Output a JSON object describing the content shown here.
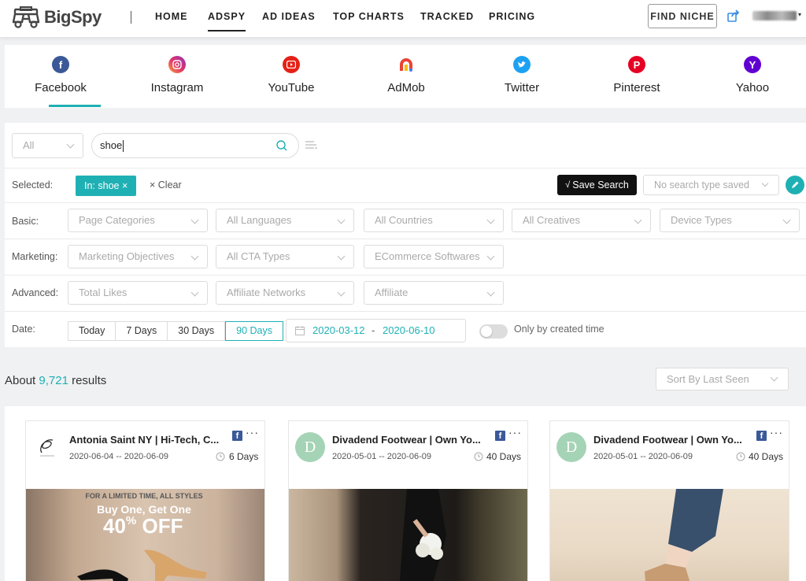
{
  "brand": {
    "name": "BigSpy"
  },
  "nav": {
    "items": [
      {
        "label": "HOME"
      },
      {
        "label": "ADSPY"
      },
      {
        "label": "AD IDEAS"
      },
      {
        "label": "TOP CHARTS"
      },
      {
        "label": "TRACKED"
      },
      {
        "label": "PRICING"
      }
    ],
    "active": "ADSPY",
    "find_niche": "FIND NICHE"
  },
  "platforms": {
    "active": "Facebook",
    "items": [
      {
        "label": "Facebook",
        "icon": "facebook-icon",
        "color": "#3b5998"
      },
      {
        "label": "Instagram",
        "icon": "instagram-icon",
        "color": "#e1306c"
      },
      {
        "label": "YouTube",
        "icon": "youtube-icon",
        "color": "#e62117"
      },
      {
        "label": "AdMob",
        "icon": "admob-icon",
        "color": "#ea4335"
      },
      {
        "label": "Twitter",
        "icon": "twitter-icon",
        "color": "#1da1f2"
      },
      {
        "label": "Pinterest",
        "icon": "pinterest-icon",
        "color": "#e60023"
      },
      {
        "label": "Yahoo",
        "icon": "yahoo-icon",
        "color": "#6001d2"
      }
    ]
  },
  "search": {
    "scope": "All",
    "query": "shoe"
  },
  "selected": {
    "label": "Selected:",
    "chip": "In: shoe ×",
    "clear": "× Clear",
    "save_search": "Save Search",
    "saved_placeholder": "No search type saved"
  },
  "filters": {
    "basic": {
      "label": "Basic:",
      "options": [
        "Page Categories",
        "All Languages",
        "All Countries",
        "All Creatives",
        "Device Types"
      ]
    },
    "marketing": {
      "label": "Marketing:",
      "options": [
        "Marketing Objectives",
        "All CTA Types",
        "ECommerce Softwares"
      ]
    },
    "advanced": {
      "label": "Advanced:",
      "options": [
        "Total Likes",
        "Affiliate Networks",
        "Affiliate"
      ]
    },
    "date": {
      "label": "Date:",
      "ranges": [
        "Today",
        "7 Days",
        "30 Days",
        "90 Days"
      ],
      "active_range": "90 Days",
      "from": "2020-03-12",
      "separator": "-",
      "to": "2020-06-10",
      "created_only_label": "Only by created time",
      "created_only": false
    }
  },
  "results": {
    "prefix": "About",
    "count": "9,721",
    "suffix": "results",
    "sort": "Sort By Last Seen"
  },
  "cards": [
    {
      "title": "Antonia Saint NY | Hi-Tech, C...",
      "dates": "2020-06-04 -- 2020-06-09",
      "days": "6 Days",
      "ad_lines": [
        "FOR A LIMITED TIME, ALL STYLES",
        "Buy One, Get One",
        "40",
        "%",
        "OFF"
      ]
    },
    {
      "title": "Divadend Footwear | Own Yo...",
      "avatar_letter": "D",
      "dates": "2020-05-01 -- 2020-06-09",
      "days": "40 Days"
    },
    {
      "title": "Divadend Footwear | Own Yo...",
      "avatar_letter": "D",
      "dates": "2020-05-01 -- 2020-06-09",
      "days": "40 Days"
    }
  ],
  "colors": {
    "accent": "#1fb0b4",
    "facebook": "#3b5998"
  }
}
